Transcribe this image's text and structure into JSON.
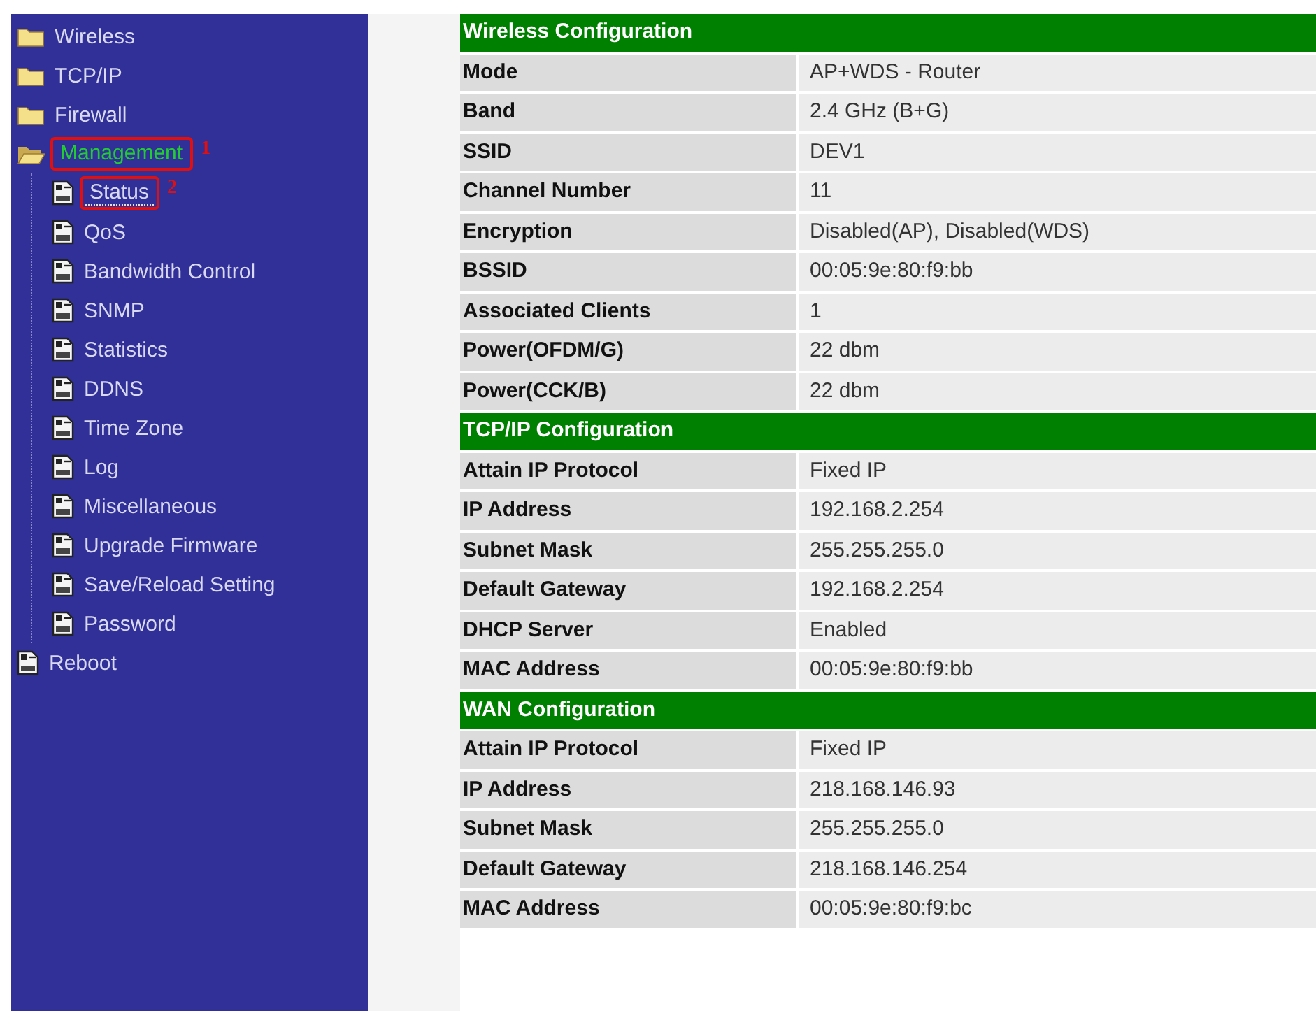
{
  "sidebar": {
    "items": [
      {
        "label": "Wireless",
        "kind": "folder",
        "expanded": false,
        "selected": false
      },
      {
        "label": "TCP/IP",
        "kind": "folder",
        "expanded": false,
        "selected": false
      },
      {
        "label": "Firewall",
        "kind": "folder",
        "expanded": false,
        "selected": false
      },
      {
        "label": "Management",
        "kind": "folder",
        "expanded": true,
        "selected": true,
        "annotation": "1",
        "children": [
          {
            "label": "Status",
            "kind": "page",
            "selected": false,
            "focused": true,
            "annotation": "2"
          },
          {
            "label": "QoS",
            "kind": "page",
            "selected": false
          },
          {
            "label": "Bandwidth Control",
            "kind": "page",
            "selected": false
          },
          {
            "label": "SNMP",
            "kind": "page",
            "selected": false
          },
          {
            "label": "Statistics",
            "kind": "page",
            "selected": false
          },
          {
            "label": "DDNS",
            "kind": "page",
            "selected": false
          },
          {
            "label": "Time Zone",
            "kind": "page",
            "selected": false
          },
          {
            "label": "Log",
            "kind": "page",
            "selected": false
          },
          {
            "label": "Miscellaneous",
            "kind": "page",
            "selected": false
          },
          {
            "label": "Upgrade Firmware",
            "kind": "page",
            "selected": false
          },
          {
            "label": "Save/Reload Setting",
            "kind": "page",
            "selected": false
          },
          {
            "label": "Password",
            "kind": "page",
            "selected": false
          }
        ]
      },
      {
        "label": "Reboot",
        "kind": "page",
        "selected": false
      }
    ]
  },
  "sections": [
    {
      "title": "Wireless Configuration",
      "rows": [
        {
          "label": "Mode",
          "value": "AP+WDS - Router"
        },
        {
          "label": "Band",
          "value": "2.4 GHz (B+G)"
        },
        {
          "label": "SSID",
          "value": "DEV1"
        },
        {
          "label": "Channel Number",
          "value": "11"
        },
        {
          "label": "Encryption",
          "value": "Disabled(AP), Disabled(WDS)"
        },
        {
          "label": "BSSID",
          "value": "00:05:9e:80:f9:bb"
        },
        {
          "label": "Associated Clients",
          "value": "1"
        },
        {
          "label": "Power(OFDM/G)",
          "value": "22 dbm"
        },
        {
          "label": "Power(CCK/B)",
          "value": "22 dbm"
        }
      ]
    },
    {
      "title": "TCP/IP Configuration",
      "rows": [
        {
          "label": "Attain IP Protocol",
          "value": "Fixed IP"
        },
        {
          "label": "IP Address",
          "value": "192.168.2.254"
        },
        {
          "label": "Subnet Mask",
          "value": "255.255.255.0"
        },
        {
          "label": "Default Gateway",
          "value": "192.168.2.254"
        },
        {
          "label": "DHCP Server",
          "value": "Enabled"
        },
        {
          "label": "MAC Address",
          "value": "00:05:9e:80:f9:bb"
        }
      ]
    },
    {
      "title": "WAN Configuration",
      "rows": [
        {
          "label": "Attain IP Protocol",
          "value": "Fixed IP"
        },
        {
          "label": "IP Address",
          "value": "218.168.146.93"
        },
        {
          "label": "Subnet Mask",
          "value": "255.255.255.0"
        },
        {
          "label": "Default Gateway",
          "value": "218.168.146.254"
        },
        {
          "label": "MAC Address",
          "value": "00:05:9e:80:f9:bc"
        }
      ]
    }
  ]
}
